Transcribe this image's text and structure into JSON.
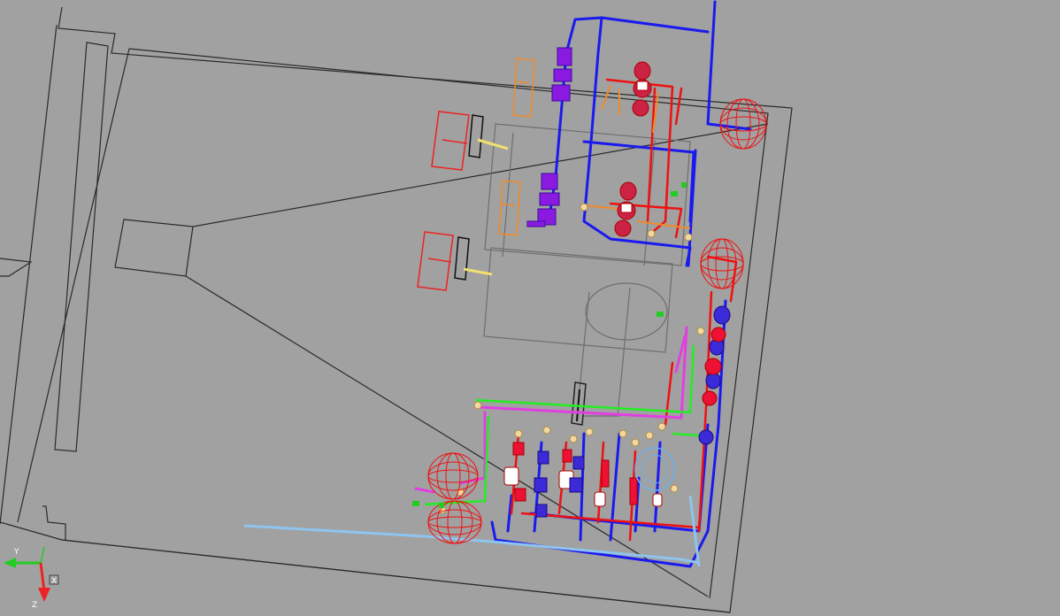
{
  "viewport": {
    "background": "#a1a1a1",
    "description_icon": "cad-3d-viewport"
  },
  "axis": {
    "x_label": "X",
    "y_label": "Y",
    "z_label": "Z",
    "colors": {
      "x": "#22cc22",
      "y": "#22cc22",
      "z": "#ee2222"
    }
  },
  "colors": {
    "outline": "#2a2a2a",
    "gray_line": "#6e6e6e",
    "blue_pipe": "#1a1aee",
    "red_pipe": "#ee1111",
    "orange": "#f08a2a",
    "purple": "#9a2ad8",
    "magenta": "#e040e0",
    "green": "#22ee22",
    "light_blue": "#8ec4ee",
    "cream": "#f0d9a0",
    "white": "#ffffff"
  }
}
